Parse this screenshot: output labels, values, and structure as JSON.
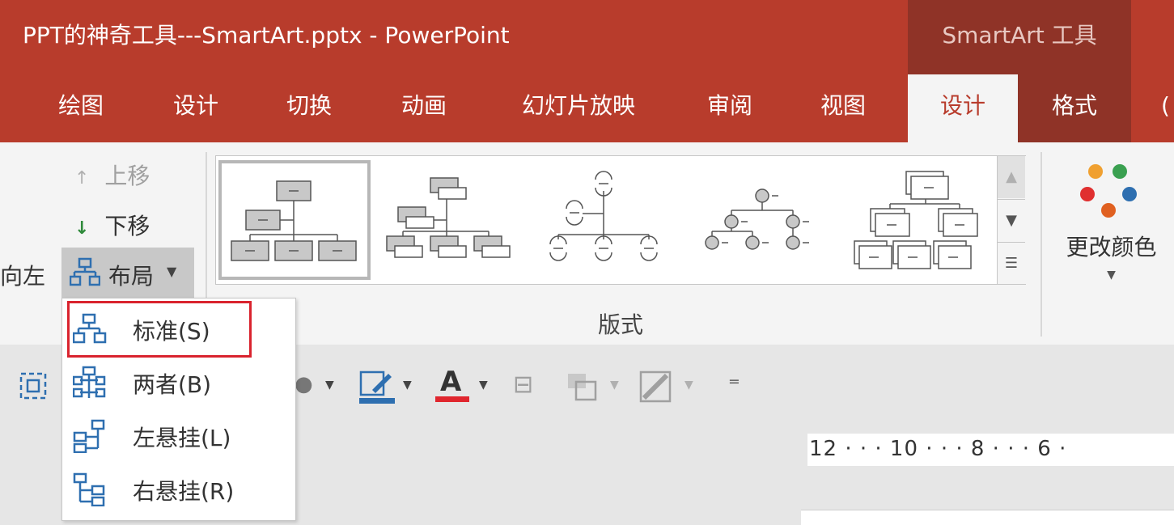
{
  "window": {
    "title": "PPT的神奇工具---SmartArt.pptx  -  PowerPoint",
    "context_group": "SmartArt 工具"
  },
  "tabs": [
    {
      "label": "绘图",
      "active": false
    },
    {
      "label": "设计",
      "active": false
    },
    {
      "label": "切换",
      "active": false
    },
    {
      "label": "动画",
      "active": false
    },
    {
      "label": "幻灯片放映",
      "active": false
    },
    {
      "label": "审阅",
      "active": false
    },
    {
      "label": "视图",
      "active": false
    },
    {
      "label": "设计",
      "active": true
    },
    {
      "label": "格式",
      "active": false
    }
  ],
  "ribbon": {
    "move_up": "上移",
    "move_down": "下移",
    "right_to_left_partial": "向左",
    "layout_button": "布局",
    "group_label": "版式",
    "change_colors": "更改颜色"
  },
  "layout_menu": {
    "items": [
      {
        "label": "标准(S)",
        "icon": "org-chart-standard-icon",
        "highlighted": true
      },
      {
        "label": "两者(B)",
        "icon": "org-chart-both-icon",
        "highlighted": false
      },
      {
        "label": "左悬挂(L)",
        "icon": "org-chart-left-hanging-icon",
        "highlighted": false
      },
      {
        "label": "右悬挂(R)",
        "icon": "org-chart-right-hanging-icon",
        "highlighted": false
      }
    ]
  },
  "ruler": {
    "text": "12 · · · 10 · · · 8 · · · 6 ·"
  },
  "colors": {
    "title_bar": "#b83c2c",
    "context_group": "#8f3327",
    "accent_blue": "#2e6fb0",
    "font_color_red": "#e0262e",
    "highlight_red": "#d9232e"
  }
}
